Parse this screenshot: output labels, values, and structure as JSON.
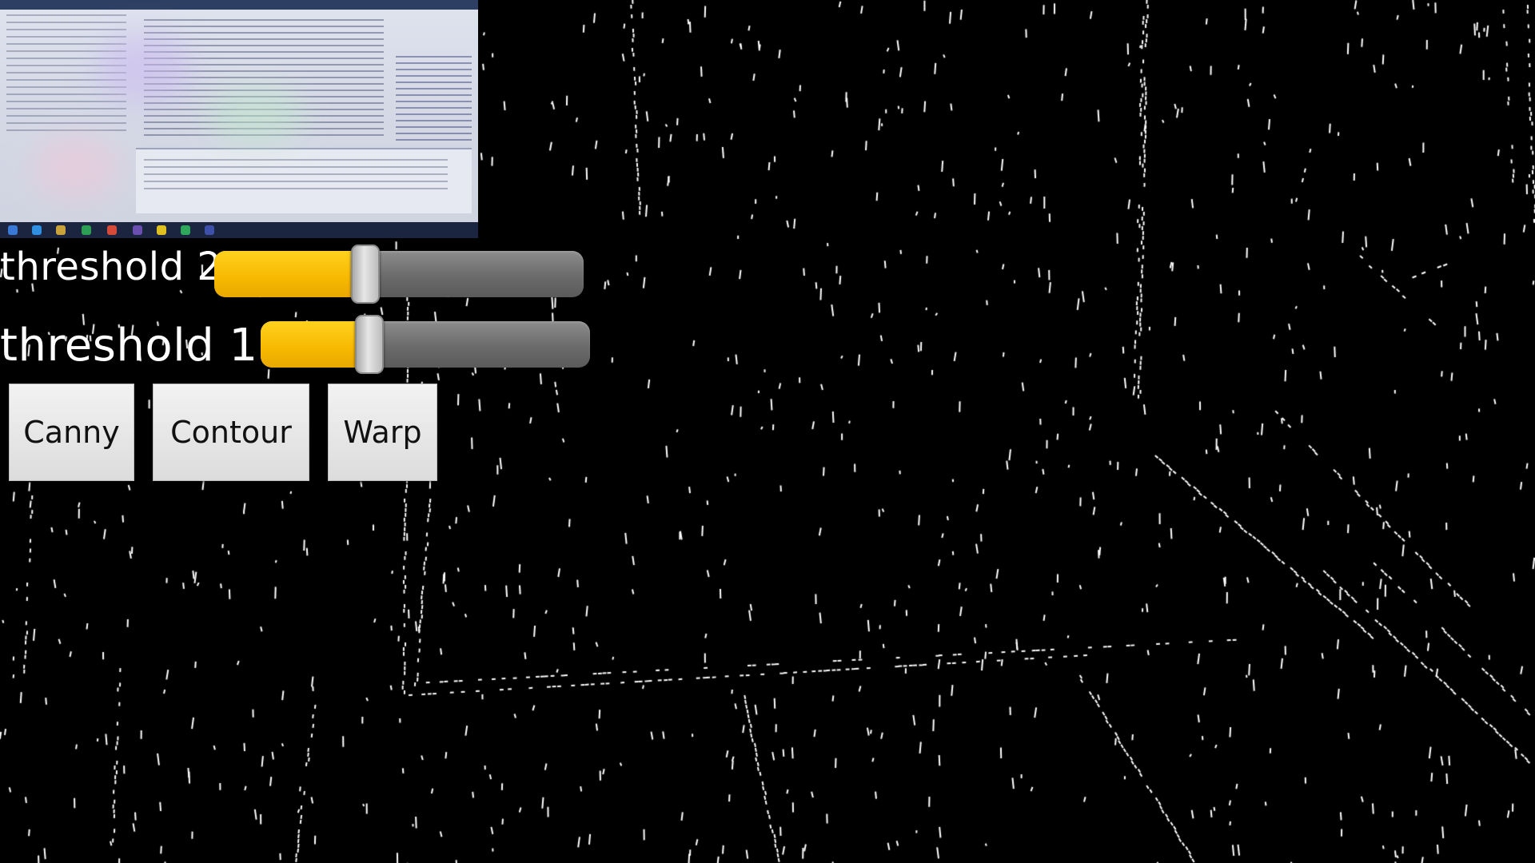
{
  "sliders": [
    {
      "label": "threshold 2",
      "value_fraction": 0.41
    },
    {
      "label": "threshold 1",
      "value_fraction": 0.33
    }
  ],
  "buttons": {
    "canny": "Canny",
    "contour": "Contour",
    "warp": "Warp"
  },
  "colors": {
    "background": "#000000",
    "edges": "#ffffff",
    "slider_fill": "#f7b800",
    "slider_track": "#6b6b6b",
    "button_face": "#e6e6e6"
  }
}
